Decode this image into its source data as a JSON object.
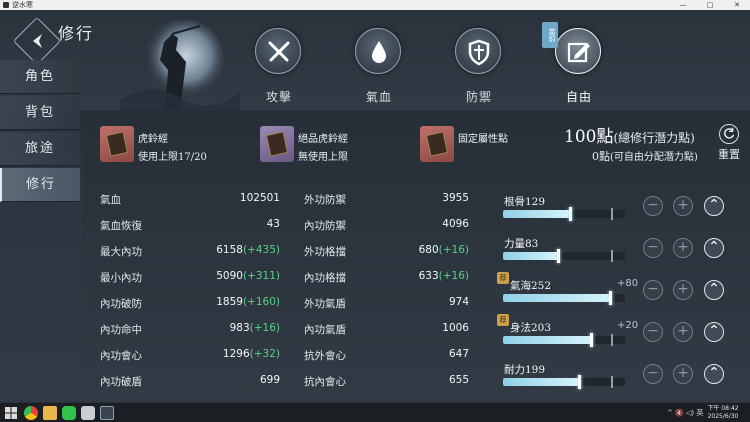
{
  "window": {
    "title": "逆水寒",
    "min": "—",
    "max": "□",
    "close": "✕"
  },
  "header": {
    "title": "修行"
  },
  "tabs": [
    {
      "label": "攻擊",
      "icon": "crossed-swords-icon",
      "active": false
    },
    {
      "label": "氣血",
      "icon": "blood-drop-icon",
      "active": false
    },
    {
      "label": "防禦",
      "icon": "shield-icon",
      "active": false
    },
    {
      "label": "自由",
      "icon": "edit-icon",
      "active": true,
      "badge": "當前"
    }
  ],
  "sidebar": {
    "items": [
      {
        "label": "角色",
        "active": false
      },
      {
        "label": "背包",
        "active": false
      },
      {
        "label": "旅途",
        "active": false
      },
      {
        "label": "修行",
        "active": true
      }
    ]
  },
  "items": [
    {
      "name": "虎鈴經",
      "sub": "使用上限17/20",
      "color": "red"
    },
    {
      "name": "絕品虎鈴經",
      "sub": "無使用上限",
      "color": "purple"
    },
    {
      "name": "固定屬性點",
      "sub": "",
      "color": "red"
    }
  ],
  "points": {
    "total_value": "100點",
    "total_label": "(總修行潛力點)",
    "free_value": "0點",
    "free_label": "(可自由分配潛力點)",
    "reset_label": "重置"
  },
  "stats_left": [
    {
      "key": "氣血",
      "value": "102501",
      "bonus": ""
    },
    {
      "key": "氣血恢復",
      "value": "43",
      "bonus": ""
    },
    {
      "key": "最大內功",
      "value": "6158",
      "bonus": "(+435)"
    },
    {
      "key": "最小內功",
      "value": "5090",
      "bonus": "(+311)"
    },
    {
      "key": "內功破防",
      "value": "1859",
      "bonus": "(+160)"
    },
    {
      "key": "內功命中",
      "value": "983",
      "bonus": "(+16)"
    },
    {
      "key": "內功會心",
      "value": "1296",
      "bonus": "(+32)"
    },
    {
      "key": "內功破盾",
      "value": "699",
      "bonus": ""
    }
  ],
  "stats_right": [
    {
      "key": "外功防禦",
      "value": "3955",
      "bonus": ""
    },
    {
      "key": "內功防禦",
      "value": "4096",
      "bonus": ""
    },
    {
      "key": "外功格擋",
      "value": "680",
      "bonus": "(+16)"
    },
    {
      "key": "內功格擋",
      "value": "633",
      "bonus": "(+16)"
    },
    {
      "key": "外功氣盾",
      "value": "974",
      "bonus": ""
    },
    {
      "key": "內功氣盾",
      "value": "1006",
      "bonus": ""
    },
    {
      "key": "抗外會心",
      "value": "647",
      "bonus": ""
    },
    {
      "key": "抗內會心",
      "value": "655",
      "bonus": ""
    }
  ],
  "attributes": [
    {
      "name": "根骨129",
      "bonus": "",
      "fill": 0.55,
      "recommended": false,
      "rec_label": ""
    },
    {
      "name": "力量83",
      "bonus": "",
      "fill": 0.45,
      "recommended": false,
      "rec_label": ""
    },
    {
      "name": "氣海252",
      "bonus": "+80",
      "fill": 0.88,
      "recommended": true,
      "rec_label": "荐"
    },
    {
      "name": "身法203",
      "bonus": "+20",
      "fill": 0.72,
      "recommended": true,
      "rec_label": "荐"
    },
    {
      "name": "耐力199",
      "bonus": "",
      "fill": 0.62,
      "recommended": false,
      "rec_label": ""
    }
  ],
  "buttons": {
    "minus": "−",
    "plus": "+",
    "max": "⌃"
  },
  "taskbar": {
    "tray_text": "^ 🔇 ◁) 英",
    "time": "下午 08:42",
    "date": "2025/6/30"
  }
}
